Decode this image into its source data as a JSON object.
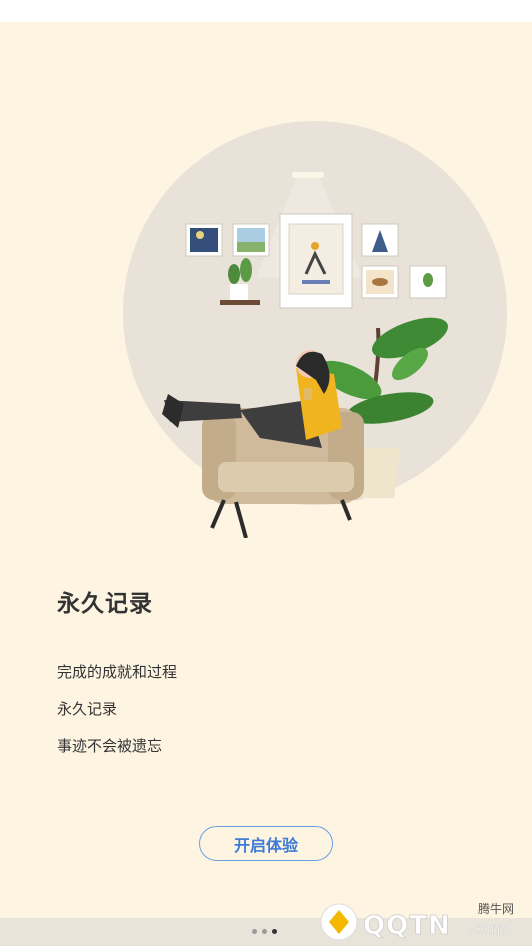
{
  "onboarding": {
    "title": "永久记录",
    "lines": [
      "完成的成就和过程",
      "永久记录",
      "事迹不会被遗忘"
    ],
    "start_button": "开启体验"
  },
  "pager": {
    "total": 3,
    "active_index": 2
  },
  "watermark": {
    "site": "腾牛网",
    "logo_text": "QQTN.com"
  },
  "colors": {
    "background": "#fdf4e2",
    "accent": "#3d7bd6",
    "illustration_circle": "#e9e2d9"
  }
}
